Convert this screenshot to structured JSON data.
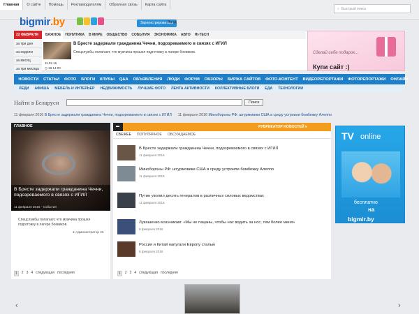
{
  "topnav": [
    "Главная",
    "О сайте",
    "Помощь",
    "Рекламодателям",
    "Обратная связь",
    "Карта сайта"
  ],
  "search": {
    "placeholder": "Быстрый поиск"
  },
  "logo": {
    "main": "bigmir",
    "tld": ".by"
  },
  "auth": {
    "register": "Зарегистрироваться",
    "login": "Вход"
  },
  "date_badge": "22 ФЕВРАЛЯ",
  "periods": [
    "за три дня",
    "за неделю",
    "за месяц",
    "за три месяца"
  ],
  "categories": [
    "ВАЖНОЕ",
    "ПОЛИТИКА",
    "В МИРЕ",
    "ОБЩЕСТВО",
    "СОБЫТИЯ",
    "ЭКОНОМИКА",
    "АВТО",
    "HI-TECH"
  ],
  "featured": {
    "title": "В Бресте задержали гражданина Чечни, подозреваемого в связях с ИГИЛ",
    "subtitle": "Спецслужбы полагают, что мужчина прошел подготовку в лагере боевиков.",
    "date": "11.02.16",
    "time": "16:14:00"
  },
  "banner1": {
    "tagline": "Сделай себе подарок...",
    "cta": "Купи сайт :)"
  },
  "mainnav": [
    "НОВОСТИ",
    "СТАТЬИ",
    "ФОТО",
    "БЛОГИ",
    "КЛУБЫ",
    "Q&A",
    "ОБЪЯВЛЕНИЯ",
    "ЛЮДИ",
    "ФОРУМ",
    "ОБЗОРЫ",
    "БИРЖА САЙТОВ",
    "ФОТО-КОНТЕНТ",
    "ВИДЕОРЕПОРТАЖИ",
    "ФОТОРЕПОРТАЖИ",
    "ОНЛАЙН"
  ],
  "subnav": [
    "ЛЕДИ",
    "АФИША",
    "МЕБЕЛЬ И ИНТЕРЬЕР",
    "НЕДВИЖИМОСТЬ",
    "ЛУЧШИЕ ФОТО",
    "ЛЕНТА АКТИВНОСТИ",
    "КОЛЛЕКТИВНЫЕ БЛОГИ",
    "ЕДА",
    "ТЕХНОЛОГИИ"
  ],
  "finder": {
    "label": "Найти в Беларуси",
    "button": "Поиск"
  },
  "ticker": [
    {
      "date": "11 февраля 2016",
      "text": "В Бресте задержали гражданина Чечни, подозреваемого в связях с ИГИЛ"
    },
    {
      "date": "11 февраля 2016",
      "text": "Минобороны РФ: штурмовики США в среду устроили бомбежку Алеппо"
    }
  ],
  "left_panel": {
    "heading": "ГЛАВНОЕ",
    "title": "В Бресте задержали гражданина Чечни, подозреваемого в связях с ИГИЛ",
    "meta": "11 февраля 2016 - События",
    "subtitle": "Спецслужбы полагают, что мужчина прошел подготовку в лагере боевиков.",
    "author": "Администратор",
    "comments": "26",
    "pages": [
      "1",
      "2",
      "3",
      "4"
    ],
    "next": "следующая",
    "last": "последняя"
  },
  "center_panel": {
    "rubricator": "РУБРИКАТОР НОВОСТЕЙ",
    "tabs": [
      "СВЕЖЕЕ",
      "ПОПУЛЯРНОЕ",
      "ОБСУЖДАЕМОЕ"
    ],
    "items": [
      {
        "title": "В Бресте задержали гражданина Чечни, подозреваемого в связях с ИГИЛ",
        "date": "11 февраля 2016",
        "thumb": "#6a5646"
      },
      {
        "title": "Минобороны РФ: штурмовики США в среду устроили бомбежку Алеппо",
        "date": "11 февраля 2016",
        "thumb": "#7e8b94"
      },
      {
        "title": "Путин уволил десять генералов в различных силовых ведомствах",
        "date": "11 февраля 2016",
        "thumb": "#39404a"
      },
      {
        "title": "Лукашенко мэзэникам: «Мы не пацаны, чтобы нас водить за нос, тем более меня»",
        "date": "8 февраля 2016",
        "thumb": "#3a4f7a"
      },
      {
        "title": "Россия и Китай напугали Европу сталью",
        "date": "8 февраля 2016",
        "thumb": "#5a3a2a"
      }
    ],
    "pages": [
      "1",
      "2",
      "3",
      "4"
    ],
    "next": "следующая",
    "last": "последняя"
  },
  "tv_ad": {
    "brand": "TV",
    "online": "online",
    "free": "бесплатно",
    "on": "на",
    "site": "bigmir.by"
  },
  "colors": {
    "brand_blue": "#1e7fc8",
    "accent_orange": "#f39c1d",
    "date_red": "#d9252a"
  }
}
